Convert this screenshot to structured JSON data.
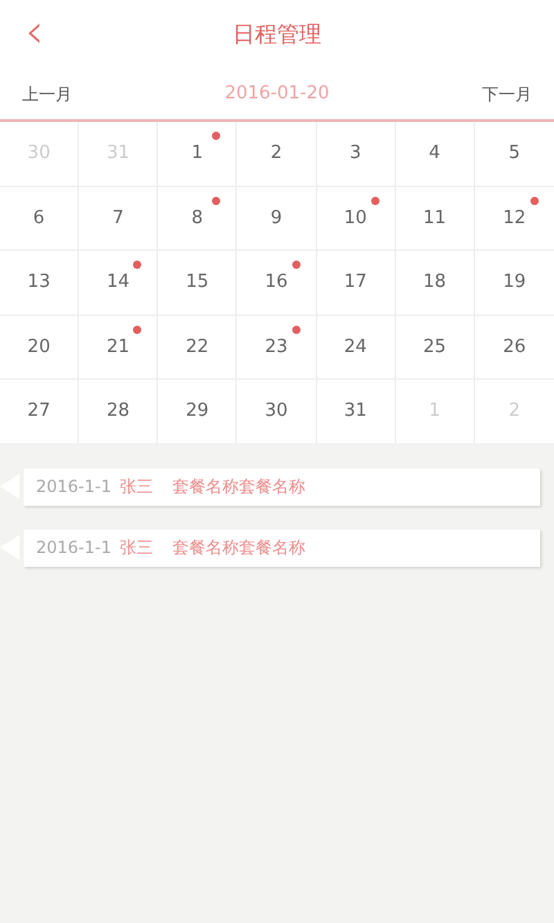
{
  "header": {
    "back_icon": "‹",
    "title": "日程管理"
  },
  "month_bar": {
    "prev": "上一月",
    "current": "2016-01-20",
    "next": "下一月"
  },
  "days": [
    {
      "day": "30",
      "in_month": false,
      "has_event": false
    },
    {
      "day": "31",
      "in_month": false,
      "has_event": false
    },
    {
      "day": "1",
      "in_month": true,
      "has_event": true
    },
    {
      "day": "2",
      "in_month": true,
      "has_event": false
    },
    {
      "day": "3",
      "in_month": true,
      "has_event": false
    },
    {
      "day": "4",
      "in_month": true,
      "has_event": false
    },
    {
      "day": "5",
      "in_month": true,
      "has_event": false
    },
    {
      "day": "6",
      "in_month": true,
      "has_event": false
    },
    {
      "day": "7",
      "in_month": true,
      "has_event": false
    },
    {
      "day": "8",
      "in_month": true,
      "has_event": true
    },
    {
      "day": "9",
      "in_month": true,
      "has_event": false
    },
    {
      "day": "10",
      "in_month": true,
      "has_event": true
    },
    {
      "day": "11",
      "in_month": true,
      "has_event": false
    },
    {
      "day": "12",
      "in_month": true,
      "has_event": true
    },
    {
      "day": "13",
      "in_month": true,
      "has_event": false
    },
    {
      "day": "14",
      "in_month": true,
      "has_event": true
    },
    {
      "day": "15",
      "in_month": true,
      "has_event": false
    },
    {
      "day": "16",
      "in_month": true,
      "has_event": true
    },
    {
      "day": "17",
      "in_month": true,
      "has_event": false
    },
    {
      "day": "18",
      "in_month": true,
      "has_event": false
    },
    {
      "day": "19",
      "in_month": true,
      "has_event": false
    },
    {
      "day": "20",
      "in_month": true,
      "has_event": false
    },
    {
      "day": "21",
      "in_month": true,
      "has_event": true
    },
    {
      "day": "22",
      "in_month": true,
      "has_event": false
    },
    {
      "day": "23",
      "in_month": true,
      "has_event": true
    },
    {
      "day": "24",
      "in_month": true,
      "has_event": false
    },
    {
      "day": "25",
      "in_month": true,
      "has_event": false
    },
    {
      "day": "26",
      "in_month": true,
      "has_event": false
    },
    {
      "day": "27",
      "in_month": true,
      "has_event": false
    },
    {
      "day": "28",
      "in_month": true,
      "has_event": false
    },
    {
      "day": "29",
      "in_month": true,
      "has_event": false
    },
    {
      "day": "30",
      "in_month": true,
      "has_event": false
    },
    {
      "day": "31",
      "in_month": true,
      "has_event": false
    },
    {
      "day": "1",
      "in_month": false,
      "has_event": false
    },
    {
      "day": "2",
      "in_month": false,
      "has_event": false
    }
  ],
  "events": [
    {
      "date": "2016-1-1",
      "person": "张三",
      "package": "套餐名称套餐名称"
    },
    {
      "date": "2016-1-1",
      "person": "张三",
      "package": "套餐名称套餐名称"
    }
  ]
}
